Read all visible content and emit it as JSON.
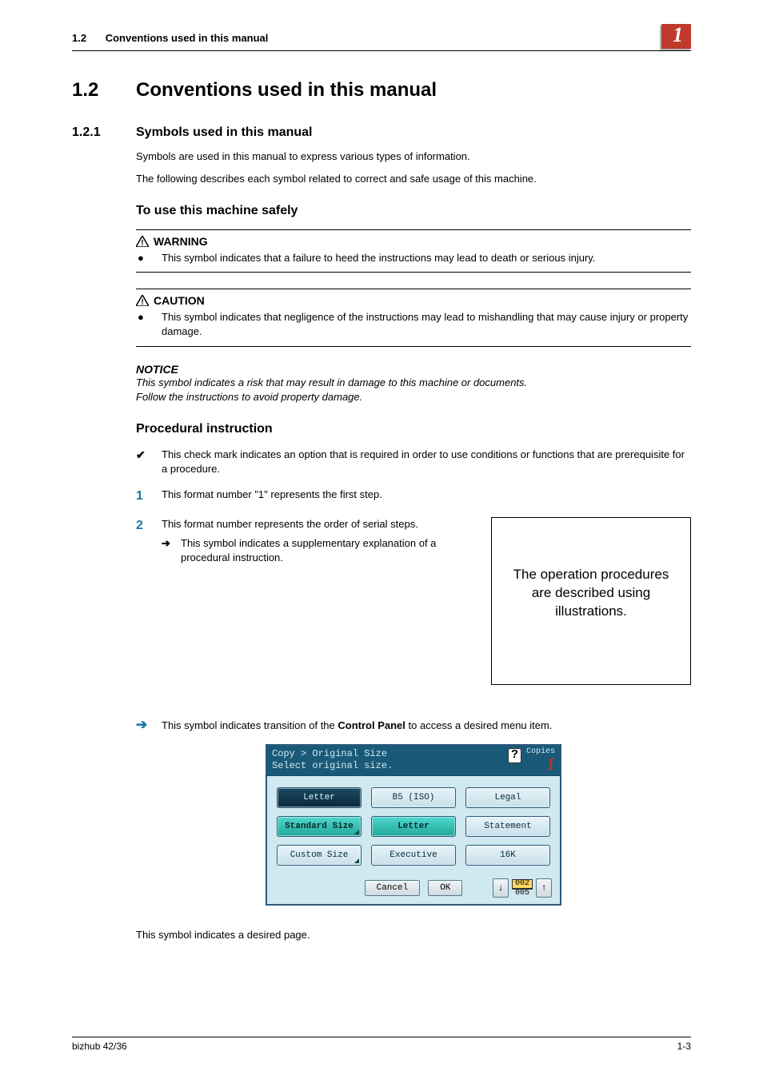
{
  "header": {
    "section_num": "1.2",
    "section_title": "Conventions used in this manual",
    "chapter_badge": "1"
  },
  "section": {
    "num": "1.2",
    "title": "Conventions used in this manual"
  },
  "subsection": {
    "num": "1.2.1",
    "title": "Symbols used in this manual",
    "intro1": "Symbols are used in this manual to express various types of information.",
    "intro2": "The following describes each symbol related to correct and safe usage of this machine."
  },
  "safety": {
    "heading": "To use this machine safely",
    "warning": {
      "label": "WARNING",
      "text": "This symbol indicates that a failure to heed the instructions may lead to death or serious injury."
    },
    "caution": {
      "label": "CAUTION",
      "text": "This symbol indicates that negligence of the instructions may lead to mishandling that may cause injury or property damage."
    },
    "notice": {
      "label": "NOTICE",
      "line1": "This symbol indicates a risk that may result in damage to this machine or documents.",
      "line2": "Follow the instructions to avoid property damage."
    }
  },
  "procedural": {
    "heading": "Procedural instruction",
    "check_text": "This check mark indicates an option that is required in order to use conditions or functions that are prerequisite for a procedure.",
    "step1_text": "This format number \"1\" represents the first step.",
    "step2_text": "This format number represents the order of serial steps.",
    "step2_sub": "This symbol indicates a supplementary explanation of a procedural instruction.",
    "callout": "The operation procedures are described using illustrations.",
    "panel_arrow_text_a": "This symbol indicates transition of the ",
    "panel_arrow_bold": "Control Panel",
    "panel_arrow_text_b": " to access a desired menu item.",
    "page_text": "This symbol indicates a desired page."
  },
  "control_panel": {
    "breadcrumb": "Copy > Original Size",
    "prompt": "Select original size.",
    "copies_label": "Copies",
    "copies_value": "1",
    "help": "?",
    "buttons": {
      "r0c0": "Letter",
      "r0c1": "B5 (ISO)",
      "r0c2": "Legal",
      "r1c0": "Standard Size",
      "r1c1": "Letter",
      "r1c2": "Statement",
      "r2c0": "Custom Size",
      "r2c1": "Executive",
      "r2c2": "16K"
    },
    "cancel": "Cancel",
    "ok": "OK",
    "page_current": "002",
    "page_total": "005"
  },
  "footer": {
    "left": "bizhub 42/36",
    "right": "1-3"
  }
}
